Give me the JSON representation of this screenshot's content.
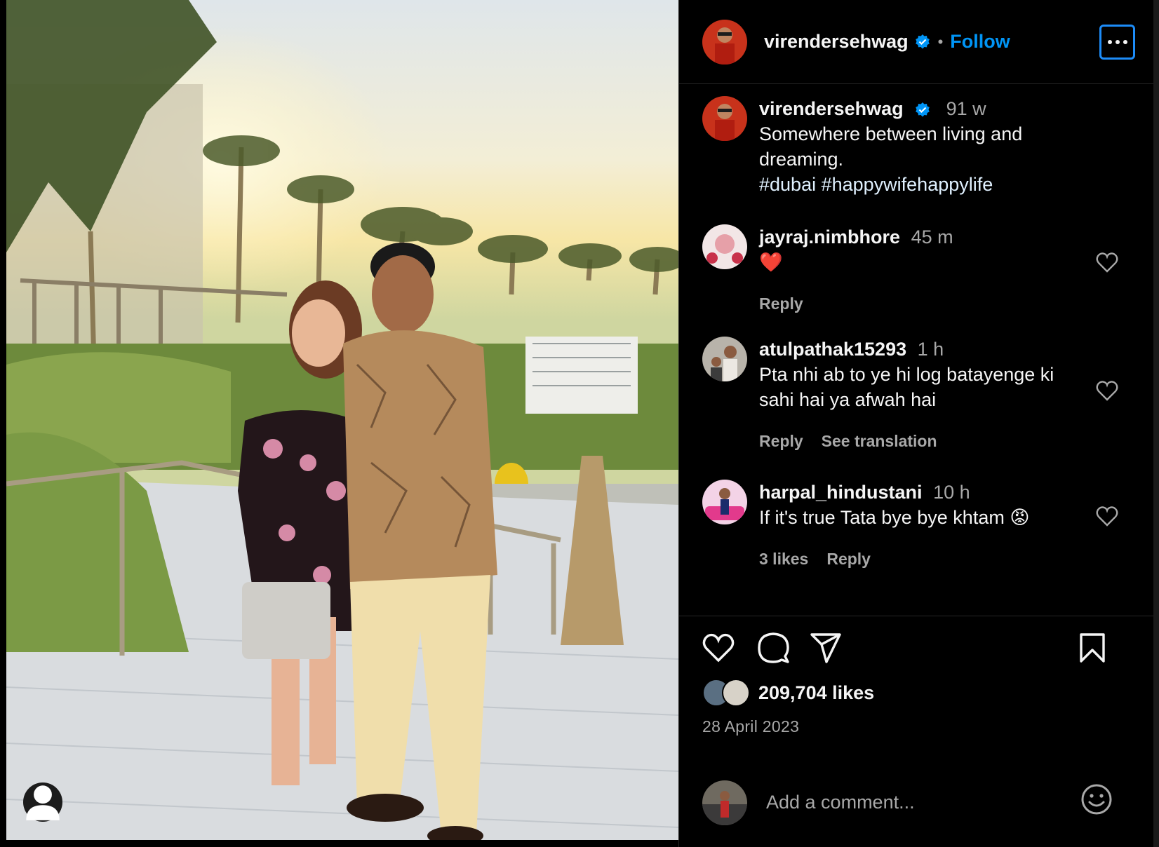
{
  "post": {
    "author": "virendersehwag",
    "follow_label": "Follow",
    "separator": "•",
    "caption_time": "91 w",
    "caption_lines": [
      "Somewhere between living and",
      "dreaming."
    ],
    "hashtags": "#dubai #happywifehappylife",
    "likes": "209,704 likes",
    "date": "28 April 2023",
    "comment_placeholder": "Add a comment..."
  },
  "comments": [
    {
      "user": "jayraj.nimbhore",
      "time": "45 m",
      "text": "❤️",
      "actions": [
        "Reply"
      ]
    },
    {
      "user": "atulpathak15293",
      "time": "1 h",
      "text_lines": [
        "Pta nhi ab to ye hi log batayenge ki",
        "sahi hai ya afwah hai"
      ],
      "actions": [
        "Reply",
        "See translation"
      ]
    },
    {
      "user": "harpal_hindustani",
      "time": "10 h",
      "text": "If it's true Tata bye bye khtam 😡",
      "actions": [
        "3 likes",
        "Reply"
      ]
    }
  ],
  "colors": {
    "accent": "#0095f6",
    "background": "#000000",
    "muted": "#a8a8a8"
  },
  "icons": [
    "more-icon",
    "verified-icon",
    "heart-icon",
    "comment-icon",
    "share-icon",
    "bookmark-icon",
    "emoji-icon",
    "user-tag-icon"
  ]
}
